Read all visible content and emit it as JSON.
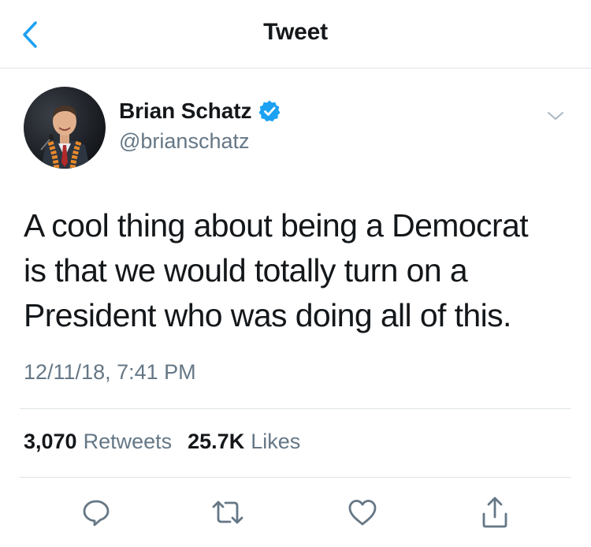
{
  "nav": {
    "title": "Tweet",
    "back_icon": "chevron-left-icon"
  },
  "author": {
    "name": "Brian Schatz",
    "handle": "@brianschatz",
    "verified": true
  },
  "tweet": {
    "text_lines": [
      "A cool thing about being a Democrat",
      "is that we would totally turn on a",
      "President who was doing all of this."
    ],
    "timestamp": "12/11/18, 7:41 PM"
  },
  "stats": {
    "retweets_count": "3,070",
    "retweets_label": "Retweets",
    "likes_count": "25.7K",
    "likes_label": "Likes"
  },
  "actions": [
    "reply-icon",
    "retweet-icon",
    "like-icon",
    "share-icon"
  ],
  "colors": {
    "accent": "#1da1f2",
    "text": "#14171a",
    "secondary": "#657786",
    "divider": "#dfe3e6",
    "icon": "#657786"
  }
}
